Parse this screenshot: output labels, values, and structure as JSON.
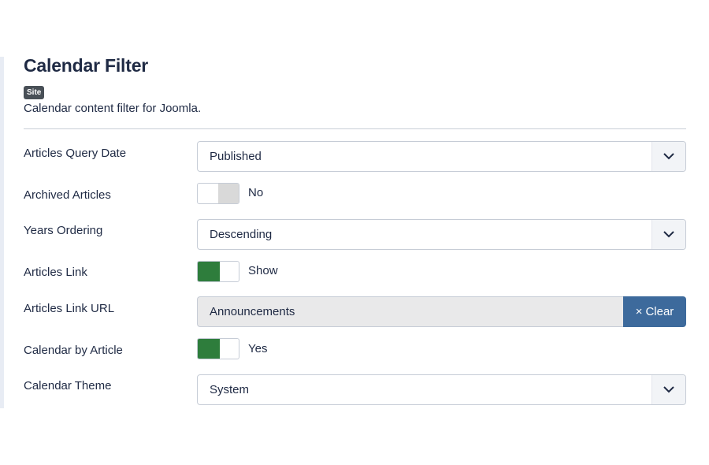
{
  "header": {
    "title": "Calendar Filter",
    "badge": "Site",
    "description": "Calendar content filter for Joomla."
  },
  "fields": {
    "query_date": {
      "label": "Articles Query Date",
      "value": "Published"
    },
    "archived": {
      "label": "Archived Articles",
      "state": "No",
      "on": false
    },
    "years_ordering": {
      "label": "Years Ordering",
      "value": "Descending"
    },
    "articles_link": {
      "label": "Articles Link",
      "state": "Show",
      "on": true
    },
    "link_url": {
      "label": "Articles Link URL",
      "value": "Announcements",
      "clear_icon": "×",
      "clear_label": "Clear"
    },
    "calendar_by_article": {
      "label": "Calendar by Article",
      "state": "Yes",
      "on": true
    },
    "calendar_theme": {
      "label": "Calendar Theme",
      "value": "System"
    }
  },
  "icons": {
    "select_arrow": "chevron-down-icon",
    "clear": "close-icon"
  },
  "colors": {
    "toggle_on": "#2e7d3c",
    "toggle_off": "#d9d9d9",
    "clear_button": "#3d6a9c",
    "badge": "#495057"
  }
}
